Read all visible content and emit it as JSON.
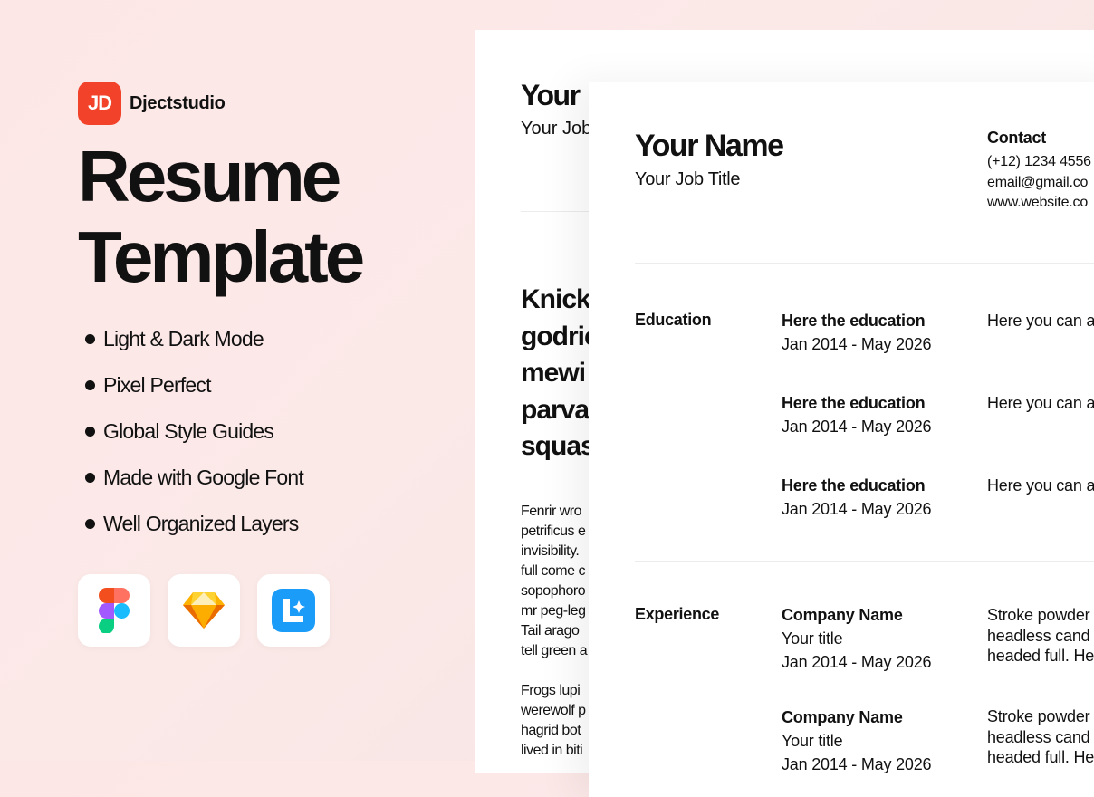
{
  "brand": {
    "logo_text": "JD",
    "name": "Djectstudio",
    "accent": "#f2432a"
  },
  "hero": {
    "title_line1": "Resume",
    "title_line2": "Template",
    "features": [
      "Light & Dark Mode",
      "Pixel Perfect",
      "Global Style Guides",
      "Made with Google Font",
      "Well Organized Layers"
    ]
  },
  "tools": [
    {
      "icon": "figma-icon"
    },
    {
      "icon": "sketch-icon"
    },
    {
      "icon": "lunacy-icon"
    }
  ],
  "back_doc": {
    "name": "Your",
    "job": "Your Job",
    "headline": [
      "Knick",
      "godric",
      "mewi",
      "parva",
      "squas"
    ],
    "para1": [
      "Fenrir wro",
      "petrificus e",
      "invisibility.",
      "full come c",
      "sopophoro",
      "mr peg-leg",
      "Tail arago",
      "tell green a"
    ],
    "para2": [
      "Frogs lupi",
      "werewolf p",
      "hagrid bot",
      "lived in biti"
    ]
  },
  "front_doc": {
    "name": "Your Name",
    "job": "Your Job Title",
    "contact_heading": "Contact",
    "contact": [
      "(+12) 1234 4556",
      "email@gmail.co",
      "www.website.co"
    ],
    "education_label": "Education",
    "education": [
      {
        "title": "Here the education",
        "dates": "Jan 2014 - May 2026",
        "desc": "Here you can a"
      },
      {
        "title": "Here the education",
        "dates": "Jan 2014 - May 2026",
        "desc": "Here you can a"
      },
      {
        "title": "Here the education",
        "dates": "Jan 2014 - May 2026",
        "desc": "Here you can a"
      }
    ],
    "experience_label": "Experience",
    "experience": [
      {
        "company": "Company Name",
        "title": "Your title",
        "dates": "Jan 2014 - May 2026",
        "desc": [
          "Stroke powder",
          "headless cand",
          "headed full. He"
        ]
      },
      {
        "company": "Company Name",
        "title": "Your title",
        "dates": "Jan 2014 - May 2026",
        "desc": [
          "Stroke powder",
          "headless cand",
          "headed full. He"
        ]
      }
    ]
  }
}
